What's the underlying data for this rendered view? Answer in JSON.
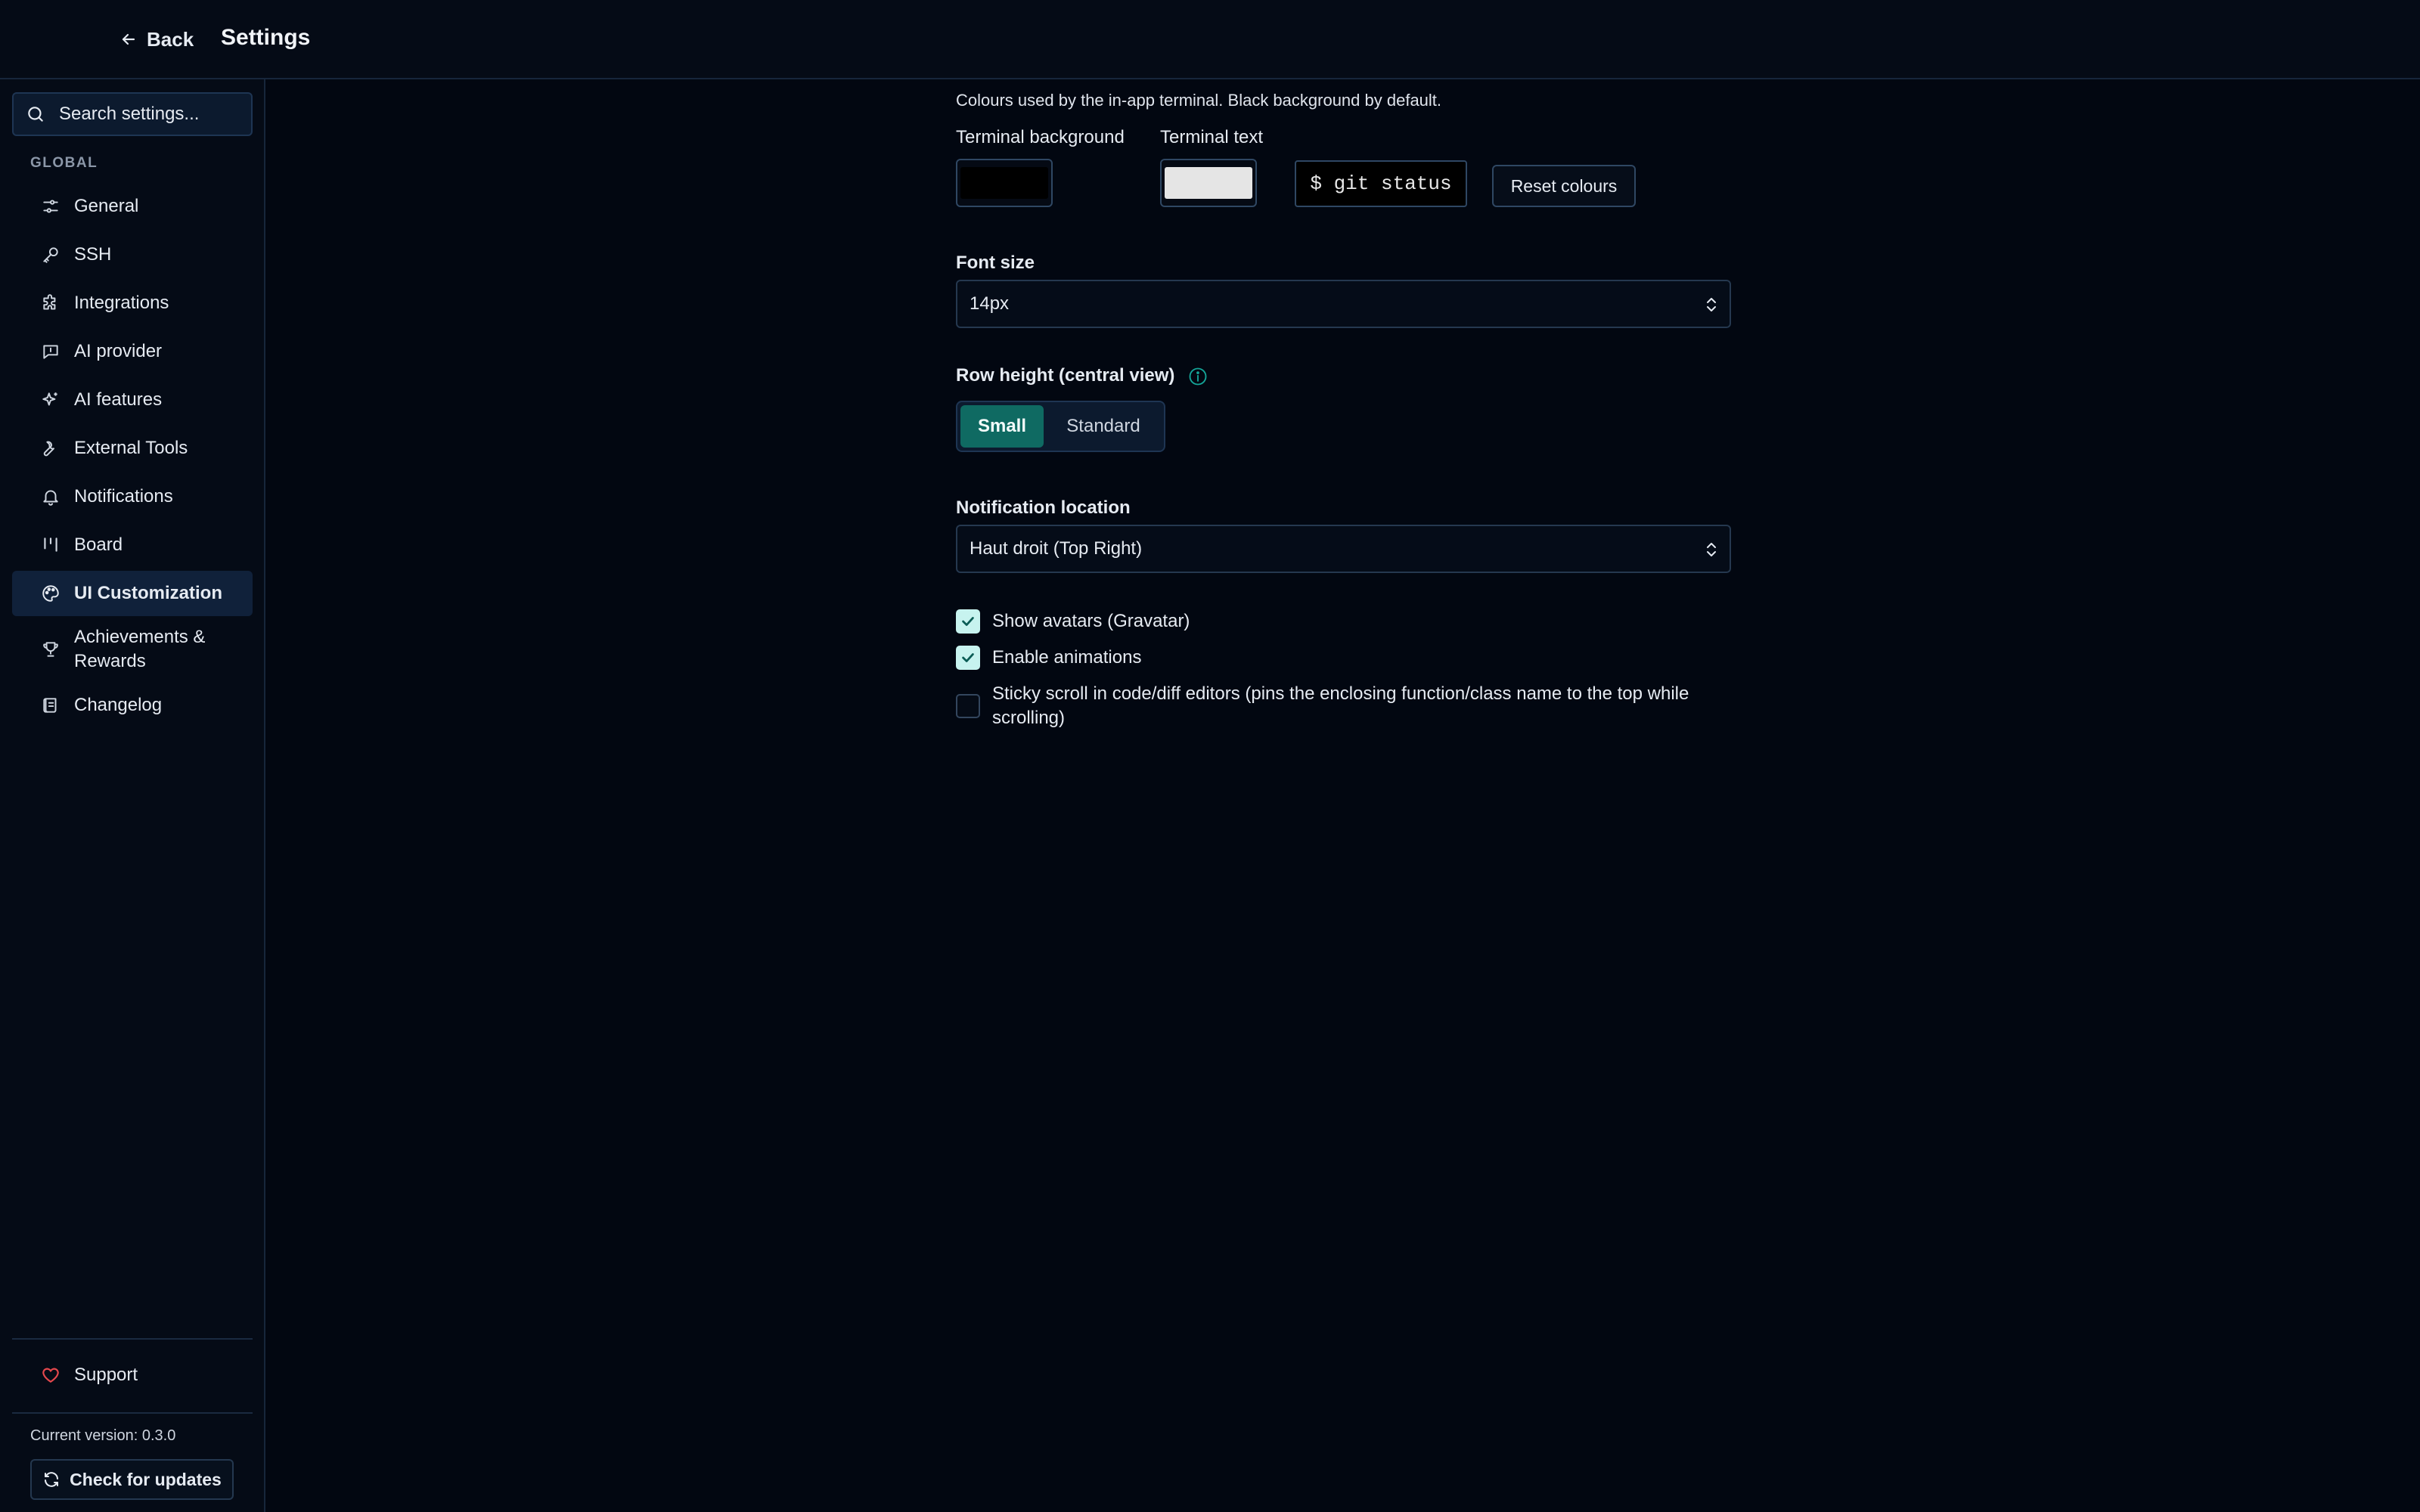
{
  "header": {
    "back_label": "Back",
    "title": "Settings"
  },
  "sidebar": {
    "search_placeholder": "Search settings...",
    "group_label": "GLOBAL",
    "items": [
      {
        "label": "General",
        "icon": "sliders-icon"
      },
      {
        "label": "SSH",
        "icon": "key-icon"
      },
      {
        "label": "Integrations",
        "icon": "puzzle-icon"
      },
      {
        "label": "AI provider",
        "icon": "message-square-icon"
      },
      {
        "label": "AI features",
        "icon": "sparkles-icon"
      },
      {
        "label": "External Tools",
        "icon": "wrench-icon"
      },
      {
        "label": "Notifications",
        "icon": "bell-icon"
      },
      {
        "label": "Board",
        "icon": "kanban-icon"
      },
      {
        "label": "UI Customization",
        "icon": "palette-icon",
        "active": true
      },
      {
        "label": "Achievements & Rewards",
        "icon": "trophy-icon"
      },
      {
        "label": "Changelog",
        "icon": "scroll-icon"
      }
    ],
    "support_label": "Support",
    "version_text": "Current version: 0.3.0",
    "check_updates_label": "Check for updates"
  },
  "content": {
    "terminal_description": "Colours used by the in-app terminal. Black background by default.",
    "terminal_background_label": "Terminal background",
    "terminal_text_label": "Terminal text",
    "terminal_background_color": "#000000",
    "terminal_text_color": "#e5e5e5",
    "preview_text": "$ git status",
    "reset_label": "Reset colours",
    "font_size_label": "Font size",
    "font_size_value": "14px",
    "row_height_label": "Row height (central view)",
    "row_height_options": [
      "Small",
      "Standard"
    ],
    "row_height_selected": "Small",
    "notification_location_label": "Notification location",
    "notification_location_value": "Haut droit (Top Right)",
    "checkboxes": [
      {
        "label": "Show avatars (Gravatar)",
        "checked": true
      },
      {
        "label": "Enable animations",
        "checked": true
      },
      {
        "label": "Sticky scroll in code/diff editors (pins the enclosing function/class name to the top while scrolling)",
        "checked": false
      }
    ]
  },
  "colors": {
    "accent": "#0f6a62",
    "background": "#020711",
    "checkbox_checked": "#c7f3ef",
    "support_heart": "#e5484d"
  }
}
